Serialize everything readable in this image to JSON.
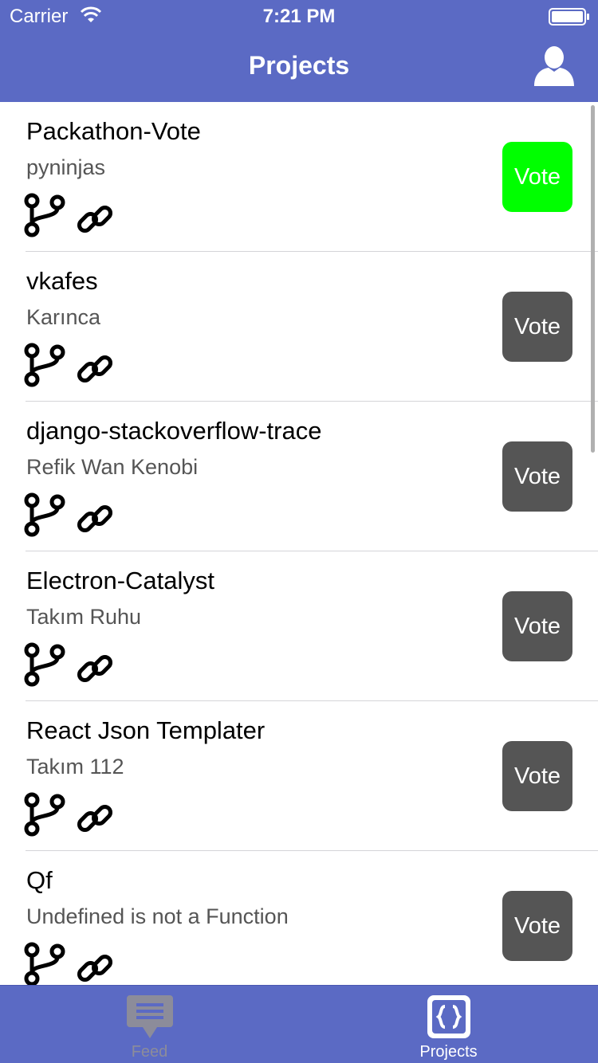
{
  "status_bar": {
    "carrier": "Carrier",
    "time": "7:21 PM"
  },
  "nav": {
    "title": "Projects",
    "profile_icon": "person-icon"
  },
  "projects": [
    {
      "title": "Packathon-Vote",
      "team": "pyninjas",
      "vote_label": "Vote",
      "voted": true
    },
    {
      "title": "vkafes",
      "team": "Karınca",
      "vote_label": "Vote",
      "voted": false
    },
    {
      "title": "django-stackoverflow-trace",
      "team": "Refik Wan Kenobi",
      "vote_label": "Vote",
      "voted": false
    },
    {
      "title": "Electron-Catalyst",
      "team": "Takım Ruhu",
      "vote_label": "Vote",
      "voted": false
    },
    {
      "title": "React Json Templater",
      "team": "Takım 112",
      "vote_label": "Vote",
      "voted": false
    },
    {
      "title": "Qf",
      "team": "Undefined is not a Function",
      "vote_label": "Vote",
      "voted": false
    }
  ],
  "tabs": [
    {
      "label": "Feed",
      "icon": "chat-bubble-icon",
      "active": false
    },
    {
      "label": "Projects",
      "icon": "code-braces-icon",
      "active": true
    }
  ],
  "colors": {
    "primary": "#5b6ac4",
    "voted": "#00ff00",
    "vote_default": "#555555",
    "inactive_tab": "#8c8c9a"
  }
}
